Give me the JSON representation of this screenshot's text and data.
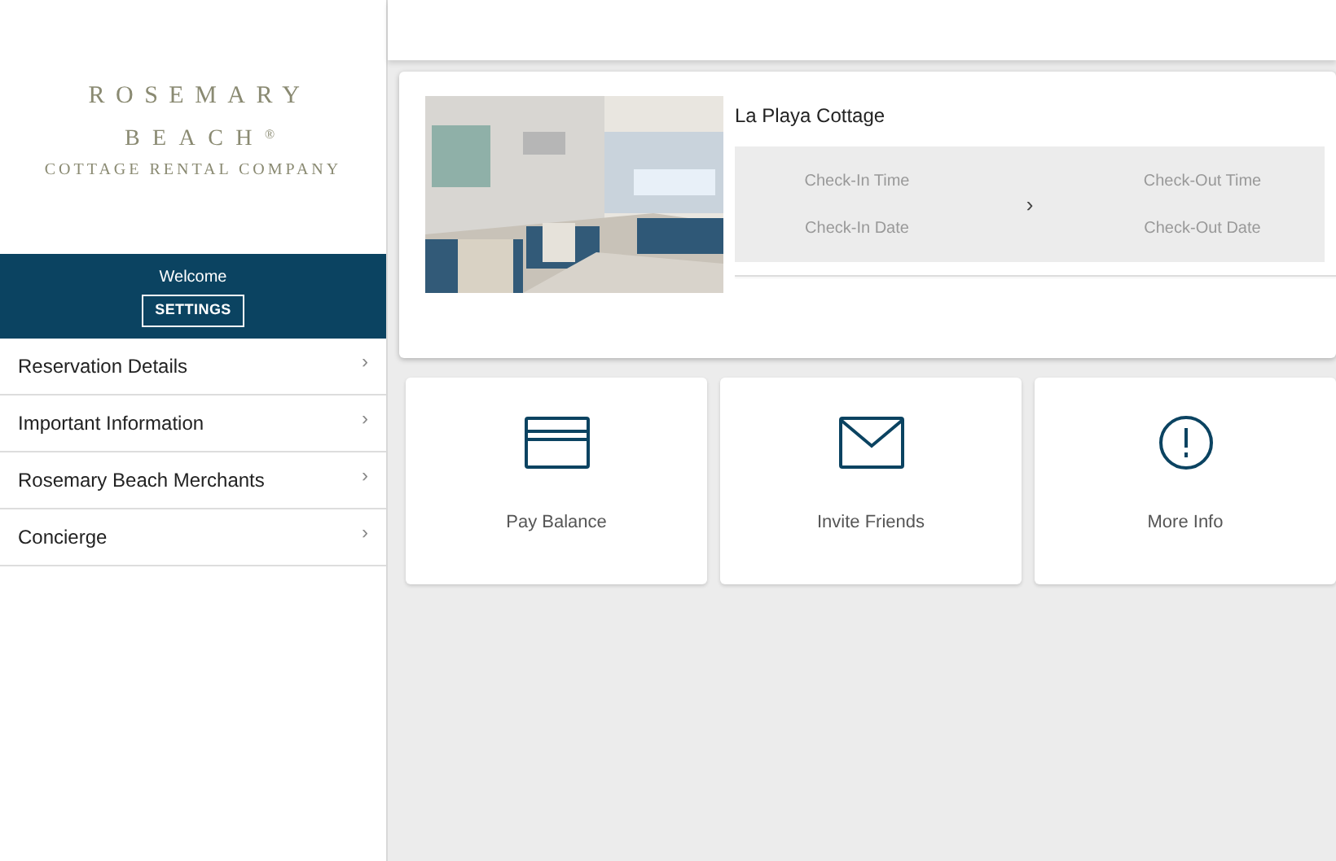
{
  "logo": {
    "line_1": "ROSEMARY",
    "line_2": "BEACH",
    "mark": "®",
    "line_3": "COTTAGE RENTAL COMPANY"
  },
  "welcome": {
    "text": "Welcome",
    "button": "SETTINGS"
  },
  "menu": [
    {
      "label": "Reservation Details",
      "icon": "›"
    },
    {
      "label": "Important Information",
      "icon": "›"
    },
    {
      "label": "Rosemary Beach Merchants",
      "icon": "›"
    },
    {
      "label": "Concierge",
      "icon": "›"
    }
  ],
  "reservation": {
    "name": "La Playa Cottage",
    "check_in_time": "Check-In Time",
    "check_in_date": "Check-In Date",
    "arrow": "›",
    "check_out_time": "Check-Out Time",
    "check_out_date": "Check-Out Date"
  },
  "tiles": [
    {
      "kind": "card",
      "label": "Pay Balance"
    },
    {
      "kind": "mail",
      "label": "Invite Friends"
    },
    {
      "kind": "info",
      "label": "More Info"
    }
  ]
}
